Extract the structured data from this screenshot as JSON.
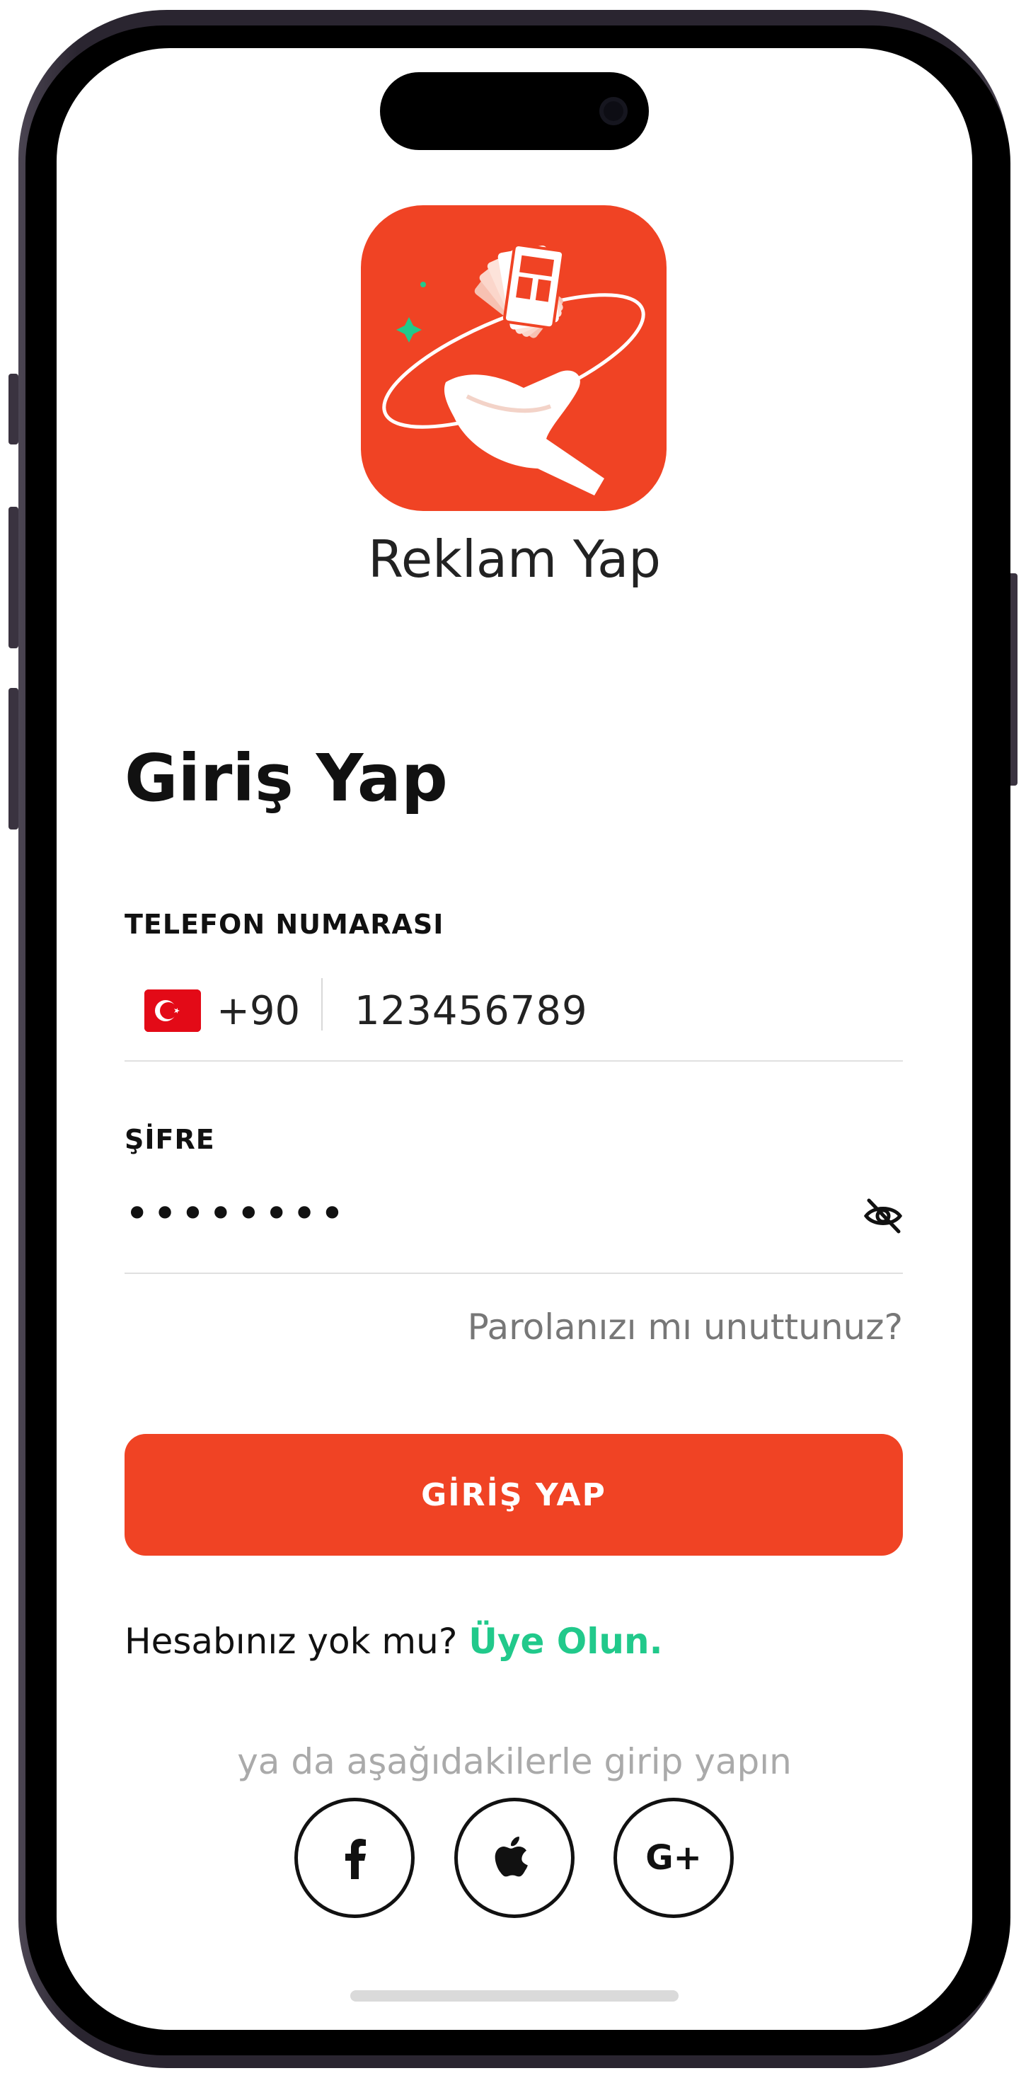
{
  "app": {
    "name": "Reklam Yap",
    "logo_color": "#f04324"
  },
  "login": {
    "title": "Giriş Yap",
    "phone_label": "TELEFON NUMARASI",
    "country_flag": "turkey-flag",
    "country_code": "+90",
    "phone_value": "123456789",
    "password_label": "ŞİFRE",
    "password_value": "••••••••",
    "forgot_link": "Parolanızı mı unuttunuz?",
    "submit_label": "GİRİŞ YAP",
    "no_account_text": "Hesabınız yok mu?",
    "signup_link": "Üye Olun.",
    "alt_login_text": "ya da aşağıdakilerle girip yapın"
  },
  "social": [
    {
      "icon": "facebook-icon"
    },
    {
      "icon": "apple-icon"
    },
    {
      "icon": "google-plus-icon",
      "label": "G+"
    }
  ],
  "colors": {
    "accent": "#f04324",
    "link": "#21c98b"
  }
}
